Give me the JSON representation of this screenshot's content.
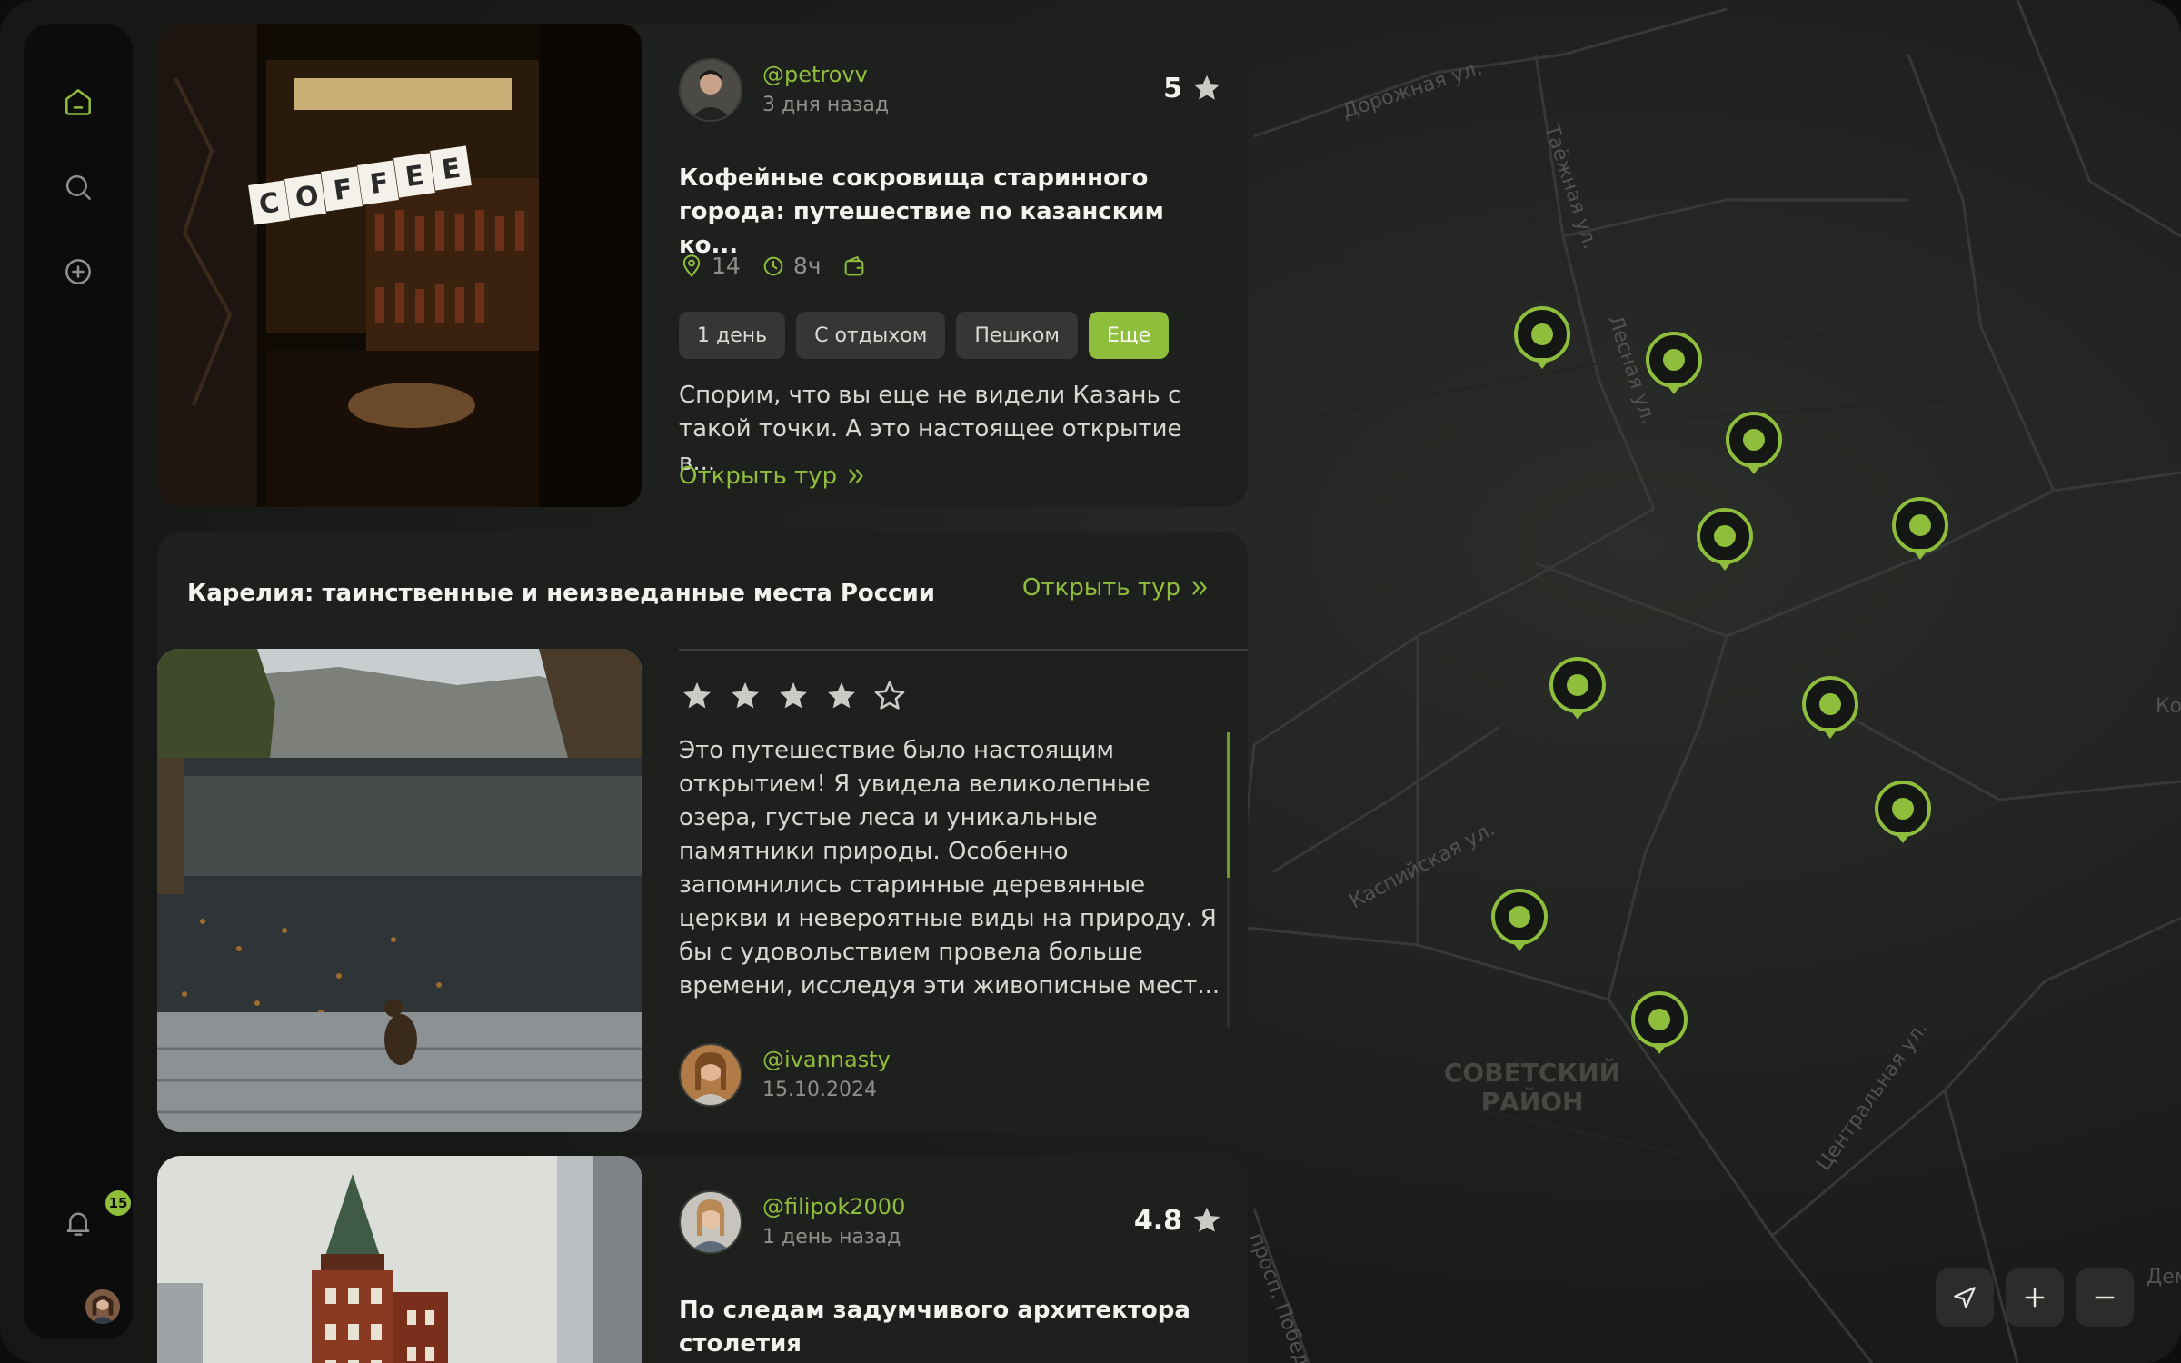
{
  "colors": {
    "accent": "#8fbd3c",
    "card": "#1e201e",
    "sidebar": "#0b0c0b",
    "text_muted": "#8d908b"
  },
  "sidebar": {
    "items": [
      {
        "icon": "home-icon",
        "active": true
      },
      {
        "icon": "search-icon",
        "active": false
      },
      {
        "icon": "add-circle-icon",
        "active": false
      }
    ],
    "notifications": {
      "icon": "bell-icon",
      "count": "15"
    },
    "profile": {
      "icon": "user-avatar"
    }
  },
  "feed": {
    "tour1": {
      "image": "coffee-shop-photo",
      "image_sign": "COFFEE",
      "author": "@petrovv",
      "date": "3 дня назад",
      "rating": "5",
      "title": "Кофейные сокровища старинного города: путешествие по казанским ко...",
      "places": "14",
      "duration": "8ч",
      "chips": [
        "1 день",
        "С отдыхом",
        "Пешком",
        "Еще"
      ],
      "description": "Спорим, что вы еще не видели Казань с такой точки. А это настоящее открытие в...",
      "link": "Открыть тур"
    },
    "review": {
      "title": "Карелия: таинственные и неизведанные места России",
      "link": "Открыть тур",
      "image": "karelia-lake-photo",
      "stars": 4,
      "stars_max": 5,
      "text": "Это путешествие было настоящим открытием! Я увидела великолепные озера, густые леса и уникальные памятники природы. Особенно запомнились старинные деревянные церкви и невероятные виды на природу. Я бы с удовольствием провела больше времени, исследуя эти живописные мест...",
      "author": "@ivannasty",
      "date": "15.10.2024"
    },
    "tour2": {
      "image": "red-tower-building-photo",
      "author": "@filipok2000",
      "date": "1 день назад",
      "rating": "4.8",
      "title": "По следам задумчивого архитектора столетия"
    }
  },
  "map": {
    "streets": [
      "Дорожная ул.",
      "Таёжная ул.",
      "Лесная ул.",
      "Каспийская ул.",
      "Центральная ул.",
      "просп. Победы",
      "Ко",
      "Демид"
    ],
    "district": [
      "СОВЕТСКИЙ",
      "РАЙОН"
    ],
    "pins": 11,
    "controls": [
      "location-arrow-icon",
      "zoom-in-icon",
      "zoom-out-icon"
    ]
  }
}
